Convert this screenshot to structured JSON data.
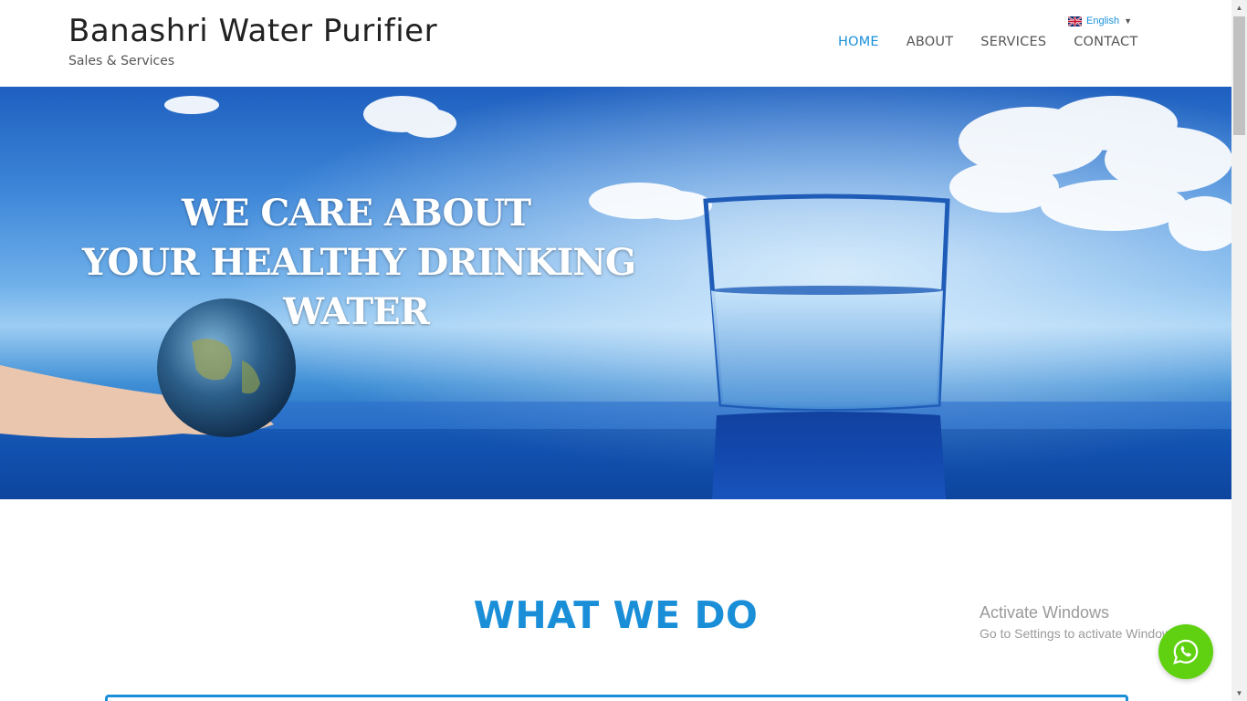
{
  "header": {
    "brand_title": "Banashri Water Purifier",
    "brand_subtitle": "Sales & Services",
    "language": "English",
    "nav": [
      {
        "label": "HOME",
        "active": true
      },
      {
        "label": "ABOUT",
        "active": false
      },
      {
        "label": "SERVICES",
        "active": false
      },
      {
        "label": "CONTACT",
        "active": false
      }
    ]
  },
  "hero": {
    "line1": "WE CARE ABOUT",
    "line2": "YOUR HEALTHY DRINKING",
    "line3": "WATER"
  },
  "main": {
    "section_title": "WHAT WE DO"
  },
  "watermark": {
    "line1": "Activate Windows",
    "line2": "Go to Settings to activate Windows."
  },
  "icons": {
    "flag": "uk-flag-icon",
    "whatsapp": "whatsapp-icon"
  },
  "colors": {
    "accent": "#1a8fd8",
    "whatsapp": "#5fd111",
    "nav_text": "#555555"
  }
}
